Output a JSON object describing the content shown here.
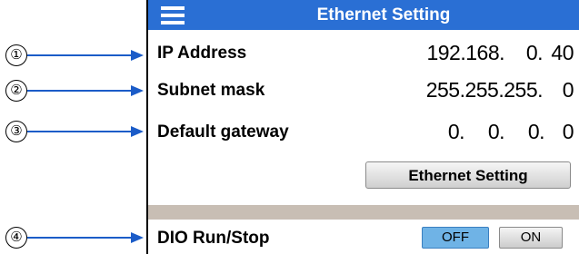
{
  "screen": {
    "title": "Ethernet Setting",
    "rows": [
      {
        "label": "IP Address",
        "value": [
          "192.168.",
          "0.",
          "40"
        ]
      },
      {
        "label": "Subnet mask",
        "value": [
          "255.255.255.",
          "0"
        ]
      },
      {
        "label": "Default gateway",
        "value": [
          "0.",
          "0.",
          "0.",
          "0"
        ]
      }
    ],
    "ethernet_button": "Ethernet Setting",
    "dio": {
      "label": "DIO Run/Stop",
      "off": "OFF",
      "on": "ON"
    }
  },
  "callouts": [
    "①",
    "②",
    "③",
    "④"
  ],
  "colors": {
    "titlebar": "#2a6fd4",
    "off_selected": "#6fb3e6",
    "separator": "#c8beb4"
  }
}
